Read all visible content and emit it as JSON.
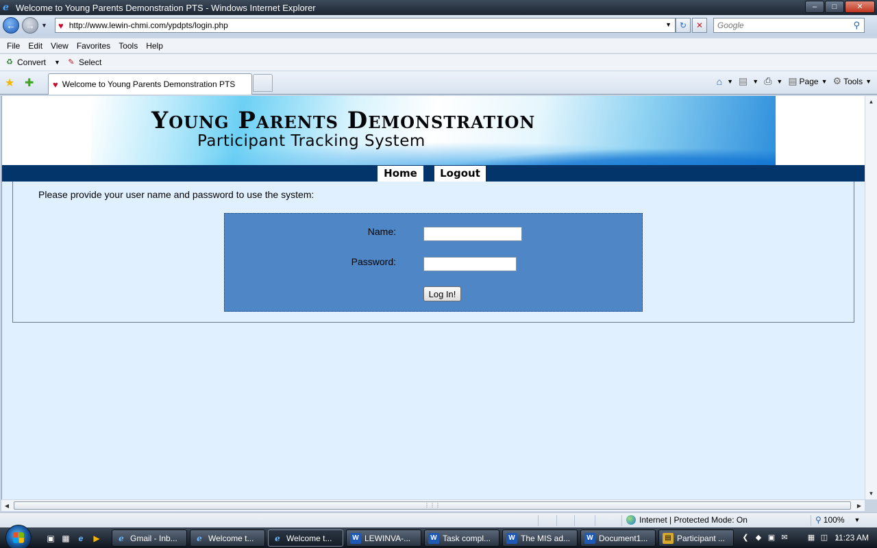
{
  "window": {
    "title": "Welcome to Young Parents Demonstration PTS - Windows Internet Explorer",
    "controls": {
      "minimize": "–",
      "maximize": "□",
      "close": "✕"
    }
  },
  "address_bar": {
    "url": "http://www.lewin-chmi.com/ypdpts/login.php",
    "search_placeholder": "Google"
  },
  "menu": [
    "File",
    "Edit",
    "View",
    "Favorites",
    "Tools",
    "Help"
  ],
  "adobe_toolbar": {
    "convert": "Convert",
    "select": "Select"
  },
  "tabs": [
    {
      "label": "Welcome to Young Parents Demonstration PTS",
      "active": true
    }
  ],
  "command_bar": {
    "page": "Page",
    "tools": "Tools"
  },
  "page": {
    "banner_title": "Young Parents Demonstration",
    "banner_subtitle": "Participant Tracking System",
    "nav": {
      "home": "Home",
      "logout": "Logout"
    },
    "prompt": "Please provide your user name and password to use the system:",
    "login": {
      "name_label": "Name:",
      "password_label": "Password:",
      "name_value": "",
      "password_value": "",
      "button": "Log In!"
    }
  },
  "status": {
    "zone": "Internet | Protected Mode: On",
    "zoom": "100%"
  },
  "taskbar": {
    "items": [
      {
        "label": "Gmail - Inb...",
        "icon": "ie-icon"
      },
      {
        "label": "Welcome t...",
        "icon": "ie-icon"
      },
      {
        "label": "Welcome t...",
        "icon": "ie-icon",
        "active": true
      },
      {
        "label": "LEWINVA-...",
        "icon": "word-icon"
      },
      {
        "label": "Task compl...",
        "icon": "word-icon"
      },
      {
        "label": "The MIS ad...",
        "icon": "word-icon"
      },
      {
        "label": "Document1...",
        "icon": "word-icon"
      },
      {
        "label": "Participant ...",
        "icon": "folder-icon"
      }
    ],
    "clock": "11:23 AM"
  },
  "colors": {
    "nav_band": "#03356b",
    "login_panel": "#4f86c6",
    "page_background": "#e1f0ff"
  }
}
